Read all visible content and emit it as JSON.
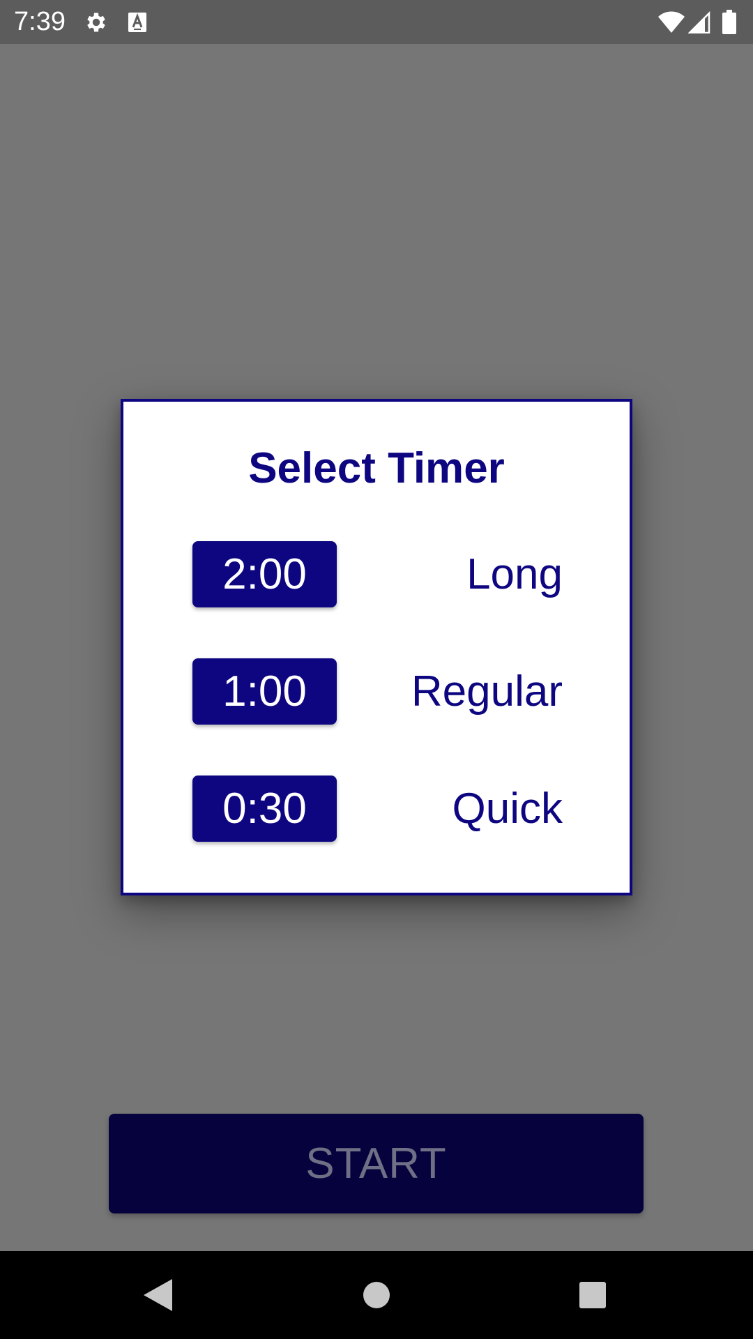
{
  "status_bar": {
    "time": "7:39",
    "icons": [
      "settings-icon",
      "a-icon",
      "wifi-icon",
      "signal-icon",
      "battery-icon"
    ]
  },
  "dialog": {
    "title": "Select Timer",
    "options": [
      {
        "time": "2:00",
        "label": "Long"
      },
      {
        "time": "1:00",
        "label": "Regular"
      },
      {
        "time": "0:30",
        "label": "Quick"
      }
    ]
  },
  "main": {
    "start_label": "START"
  },
  "colors": {
    "primary": "#0d0680",
    "start_button": "#05023d",
    "scrim": "#767676",
    "status_bar": "#5c5c5c"
  },
  "nav_bar": {
    "icons": [
      "back-icon",
      "home-icon",
      "recents-icon"
    ]
  }
}
